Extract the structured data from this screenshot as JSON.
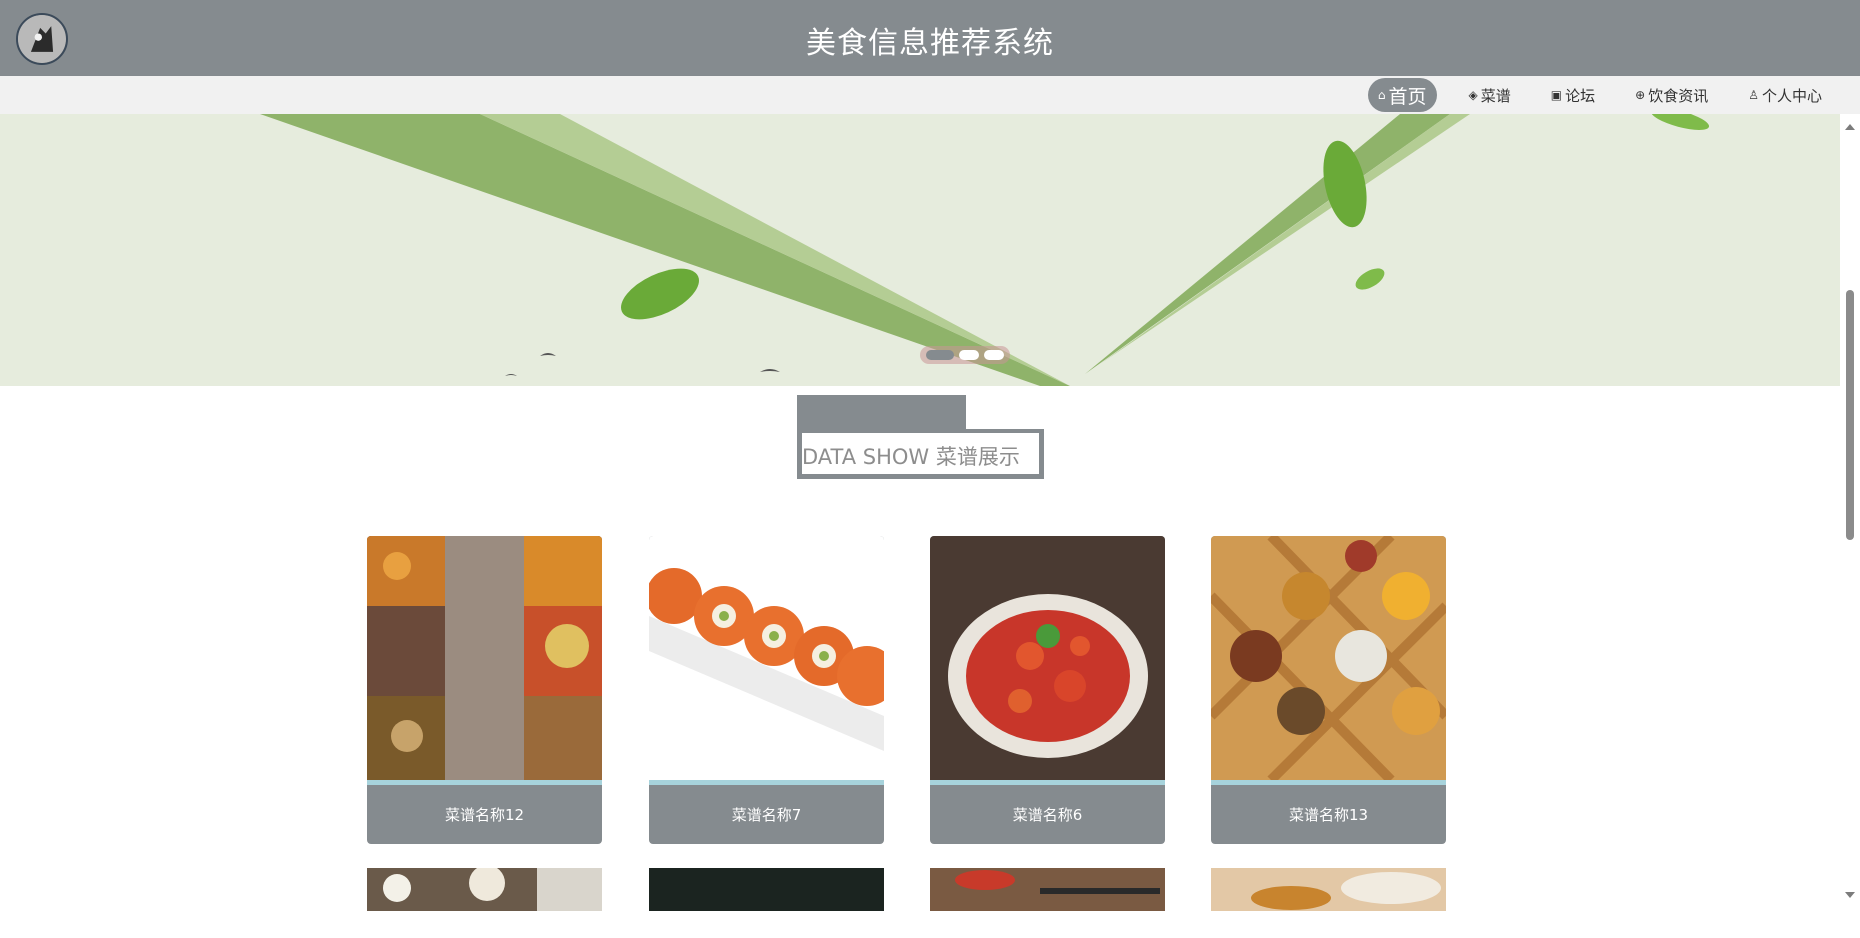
{
  "header": {
    "title": "美食信息推荐系统",
    "logo_icon": "avatar-logo"
  },
  "nav": {
    "items": [
      {
        "label": "首页",
        "icon": "home-icon",
        "active": true
      },
      {
        "label": "菜谱",
        "icon": "layers-icon",
        "active": false
      },
      {
        "label": "论坛",
        "icon": "gift-icon",
        "active": false
      },
      {
        "label": "饮食资讯",
        "icon": "globe-icon",
        "active": false
      },
      {
        "label": "个人中心",
        "icon": "user-icon",
        "active": false
      }
    ]
  },
  "banner": {
    "slides": 3,
    "active_slide": 1
  },
  "section": {
    "title": "DATA SHOW 菜谱展示"
  },
  "recipes": [
    {
      "name": "菜谱名称12"
    },
    {
      "name": "菜谱名称7"
    },
    {
      "name": "菜谱名称6"
    },
    {
      "name": "菜谱名称13"
    }
  ],
  "colors": {
    "primary": "#858b8f",
    "accent_stripe": "#a7d3dc",
    "banner_bg": "#e6ecdd",
    "nav_bg": "#f1f1f1"
  }
}
